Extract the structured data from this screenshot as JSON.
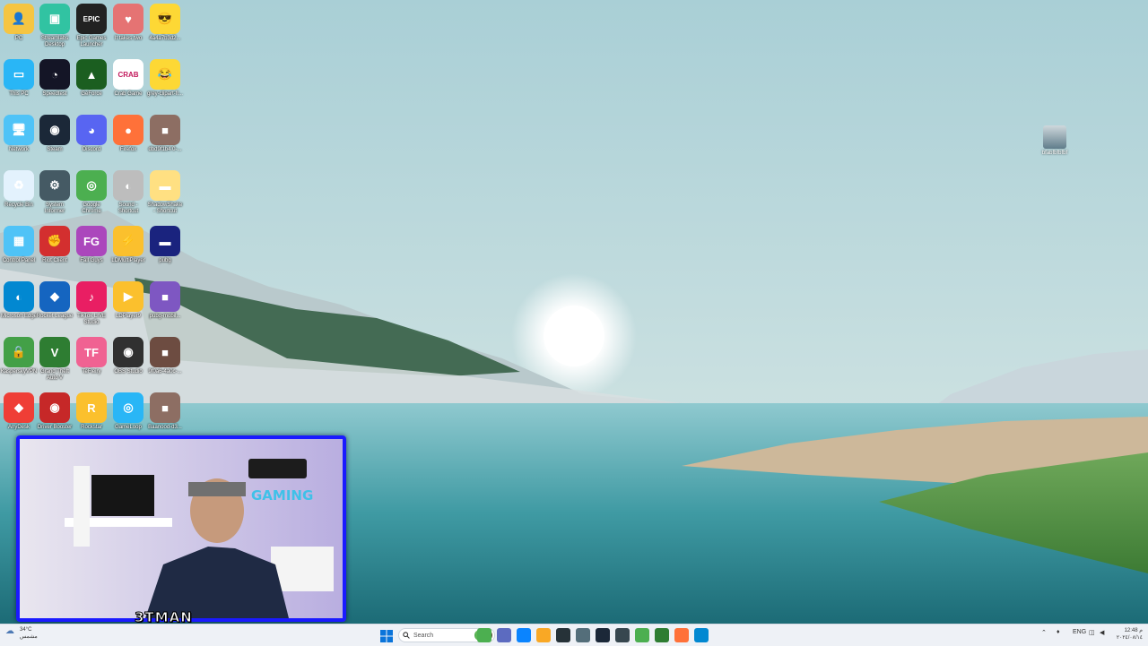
{
  "desktop": {
    "icons": [
      {
        "label": "PC",
        "glyph": "👤",
        "color": "#f5c542"
      },
      {
        "label": "Streamlabs Desktop",
        "glyph": "▣",
        "color": "#31c3a2"
      },
      {
        "label": "Epic Games Launcher",
        "glyph": "EPIC",
        "color": "#222222"
      },
      {
        "label": "It takes two",
        "glyph": "♥",
        "color": "#e57373"
      },
      {
        "label": "4a4a7b3d2...",
        "glyph": "😎",
        "color": "#fdd835"
      },
      {
        "label": "This PC",
        "glyph": "▭",
        "color": "#29b6f6"
      },
      {
        "label": "Speedtest",
        "glyph": "◔",
        "color": "#141526"
      },
      {
        "label": "GeForce",
        "glyph": "▲",
        "color": "#1b5e20"
      },
      {
        "label": "Crab Game",
        "glyph": "CRAB",
        "color": "#ffffff"
      },
      {
        "label": "grey-clipart-fr...",
        "glyph": "😂",
        "color": "#fdd835"
      },
      {
        "label": "Network",
        "glyph": "🖥",
        "color": "#4fc3f7"
      },
      {
        "label": "Steam",
        "glyph": "◉",
        "color": "#1b2838"
      },
      {
        "label": "Discord",
        "glyph": "◕",
        "color": "#5865f2"
      },
      {
        "label": "Firefox",
        "glyph": "●",
        "color": "#ff7139"
      },
      {
        "label": "dbd9f1b4 0-...",
        "glyph": "■",
        "color": "#8d6e63"
      },
      {
        "label": "Recycle Bin",
        "glyph": "♻",
        "color": "#e3f2fd"
      },
      {
        "label": "System Informer",
        "glyph": "⚙",
        "color": "#455a64"
      },
      {
        "label": "Google Chrome",
        "glyph": "◎",
        "color": "#4caf50"
      },
      {
        "label": "Sound - Shortcut",
        "glyph": "◐",
        "color": "#bdbdbd"
      },
      {
        "label": "ShadowShake - Shortcut",
        "glyph": "▬",
        "color": "#ffe082"
      },
      {
        "label": "Control Panel",
        "glyph": "▦",
        "color": "#4fc3f7"
      },
      {
        "label": "Riot Client",
        "glyph": "✊",
        "color": "#d32f2f"
      },
      {
        "label": "Fall Guys",
        "glyph": "FG",
        "color": "#ab47bc"
      },
      {
        "label": "LDMultiPlayer",
        "glyph": "⚡",
        "color": "#fbc02d"
      },
      {
        "label": "pubg",
        "glyph": "▬",
        "color": "#1a237e"
      },
      {
        "label": "Microsoft Edge",
        "glyph": "◐",
        "color": "#0288d1"
      },
      {
        "label": "Rocket League",
        "glyph": "◆",
        "color": "#1565c0"
      },
      {
        "label": "TikTok LIVE Studio",
        "glyph": "♪",
        "color": "#e91e63"
      },
      {
        "label": "LDPlayer9",
        "glyph": "▶",
        "color": "#fbc02d"
      },
      {
        "label": "pubg-mobil...",
        "glyph": "■",
        "color": "#7e57c2"
      },
      {
        "label": "KasperskyVPN",
        "glyph": "🔒",
        "color": "#43a047"
      },
      {
        "label": "Grand Theft Auto V",
        "glyph": "V",
        "color": "#2e7d32"
      },
      {
        "label": "TeFleiry",
        "glyph": "TF",
        "color": "#f06292"
      },
      {
        "label": "OBS Studio",
        "glyph": "◉",
        "color": "#303030"
      },
      {
        "label": "9f0a6-4a0c-...",
        "glyph": "■",
        "color": "#6d4c41"
      },
      {
        "label": "AnyDesk",
        "glyph": "◆",
        "color": "#ef3e36"
      },
      {
        "label": "Driver Booster",
        "glyph": "◉",
        "color": "#c62828"
      },
      {
        "label": "Rockstar",
        "glyph": "R",
        "color": "#fbc02d"
      },
      {
        "label": "GameLoop",
        "glyph": "◎",
        "color": "#29b6f6"
      },
      {
        "label": "Baanood-d3...",
        "glyph": "■",
        "color": "#8d6e63"
      }
    ],
    "right_icon": {
      "label": "bfabfbfbfbf"
    }
  },
  "webcam": {
    "streamer_name": "3TMAN",
    "room_sign": "GAMING"
  },
  "taskbar": {
    "weather_temp": "34°C",
    "weather_text": "مشمس",
    "search_placeholder": "Search",
    "apps": [
      "file-explorer",
      "teams",
      "edge",
      "folder",
      "speedtest",
      "calculator",
      "steam",
      "dashboard",
      "chrome",
      "geforce",
      "firefox",
      "photos"
    ],
    "language": "ENG",
    "time": "12:48 م",
    "date": "٢٠٢٤/٠٨/١٤"
  }
}
